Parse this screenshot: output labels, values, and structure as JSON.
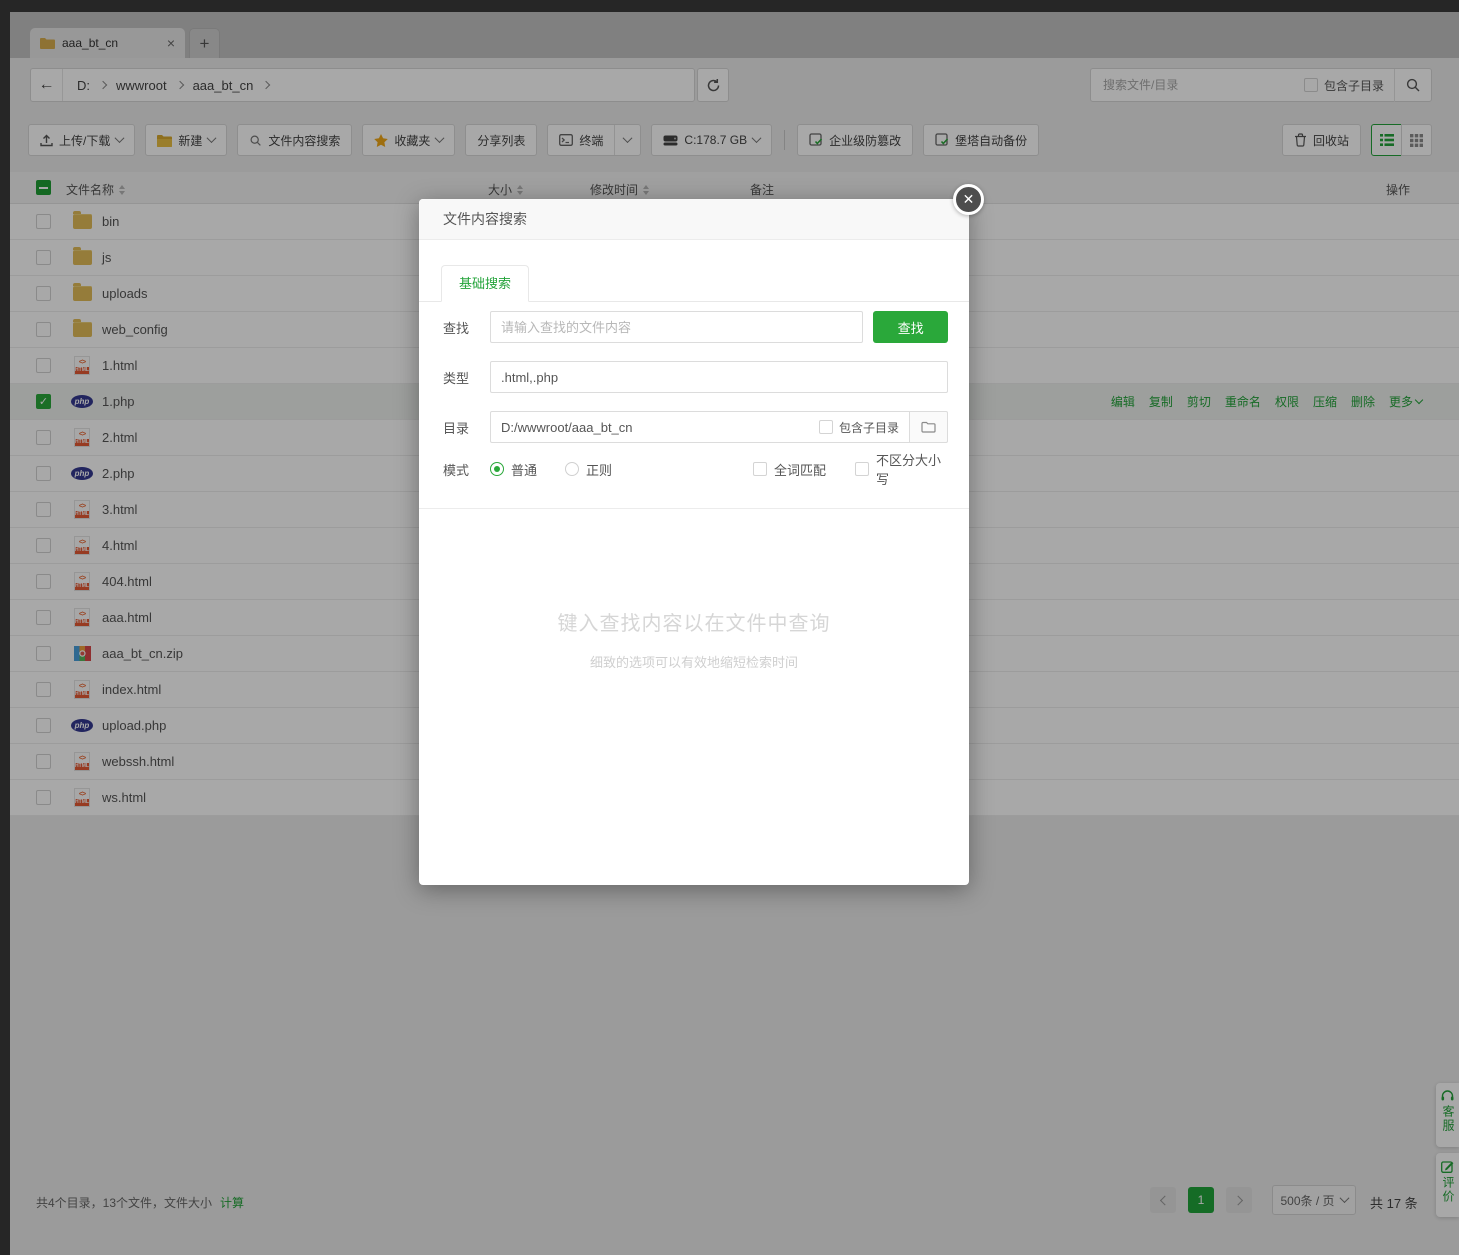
{
  "colors": {
    "accent": "#23a33a",
    "button_green": "#2aa83a",
    "folder_yellow": "#e2bc59"
  },
  "window": {
    "tab": {
      "title": "aaa_bt_cn",
      "close": "×",
      "new_tab": "+"
    },
    "breadcrumb": {
      "back": "←",
      "items": [
        "D:",
        "wwwroot",
        "aaa_bt_cn"
      ]
    },
    "top_search": {
      "placeholder": "搜索文件/目录",
      "subdir_label": "包含子目录"
    }
  },
  "toolbar": {
    "upload": "上传/下载",
    "new": "新建",
    "content_search": "文件内容搜索",
    "favorites": "收藏夹",
    "share_list": "分享列表",
    "terminal": "终端",
    "disk": "C:178.7 GB",
    "tamper_proof": "企业级防篡改",
    "auto_backup": "堡塔自动备份",
    "recycle_bin": "回收站"
  },
  "table": {
    "headers": {
      "name": "文件名称",
      "size": "大小",
      "mtime": "修改时间",
      "note": "备注",
      "ops": "操作"
    },
    "row_actions": [
      "编辑",
      "复制",
      "剪切",
      "重命名",
      "权限",
      "压缩",
      "删除",
      "更多"
    ],
    "rows": [
      {
        "name": "bin",
        "type": "folder",
        "selected": false
      },
      {
        "name": "js",
        "type": "folder",
        "selected": false
      },
      {
        "name": "uploads",
        "type": "folder",
        "selected": false
      },
      {
        "name": "web_config",
        "type": "folder",
        "selected": false
      },
      {
        "name": "1.html",
        "type": "html",
        "selected": false
      },
      {
        "name": "1.php",
        "type": "php",
        "selected": true
      },
      {
        "name": "2.html",
        "type": "html",
        "selected": false
      },
      {
        "name": "2.php",
        "type": "php",
        "selected": false
      },
      {
        "name": "3.html",
        "type": "html",
        "selected": false
      },
      {
        "name": "4.html",
        "type": "html",
        "selected": false
      },
      {
        "name": "404.html",
        "type": "html",
        "selected": false
      },
      {
        "name": "aaa.html",
        "type": "html",
        "selected": false
      },
      {
        "name": "aaa_bt_cn.zip",
        "type": "zip",
        "selected": false
      },
      {
        "name": "index.html",
        "type": "html",
        "selected": false
      },
      {
        "name": "upload.php",
        "type": "php",
        "selected": false
      },
      {
        "name": "webssh.html",
        "type": "html",
        "selected": false
      },
      {
        "name": "ws.html",
        "type": "html",
        "selected": false
      }
    ]
  },
  "modal": {
    "title": "文件内容搜索",
    "tab": "基础搜索",
    "find_label": "查找",
    "find_placeholder": "请输入查找的文件内容",
    "find_button": "查找",
    "type_label": "类型",
    "type_value": ".html,.php",
    "dir_label": "目录",
    "dir_value": "D:/wwwroot/aaa_bt_cn",
    "dir_subdir_label": "包含子目录",
    "mode_label": "模式",
    "mode_normal": "普通",
    "mode_regex": "正则",
    "mode_whole_word": "全词匹配",
    "mode_ignore_case": "不区分大小写",
    "empty_title": "键入查找内容以在文件中查询",
    "empty_subtitle": "细致的选项可以有效地缩短检索时间"
  },
  "statusbar": {
    "summary": "共4个目录，13个文件，文件大小",
    "calc_link": "计算",
    "current_page": "1",
    "page_size": "500条 / 页",
    "total": "共 17 条"
  },
  "side_buttons": {
    "support": "客服",
    "feedback": "评价"
  }
}
